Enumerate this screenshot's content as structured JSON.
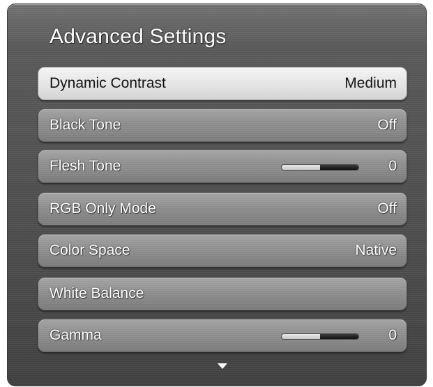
{
  "menu": {
    "title": "Advanced Settings",
    "items": [
      {
        "label": "Dynamic Contrast",
        "value": "Medium"
      },
      {
        "label": "Black Tone",
        "value": "Off"
      },
      {
        "label": "Flesh Tone",
        "value": "0",
        "slider_level": 0.5
      },
      {
        "label": "RGB Only Mode",
        "value": "Off"
      },
      {
        "label": "Color Space",
        "value": "Native"
      },
      {
        "label": "White Balance",
        "value": ""
      },
      {
        "label": "Gamma",
        "value": "0",
        "slider_level": 0.5
      }
    ],
    "selected_index": 0,
    "scroll_indicator_icon": "triangle-down"
  },
  "colors": {
    "panel": "#4c4c4c",
    "row": "#8d8d8d",
    "row_selected": "#e3e3e3",
    "text": "#ffffff",
    "text_selected": "#111111"
  }
}
